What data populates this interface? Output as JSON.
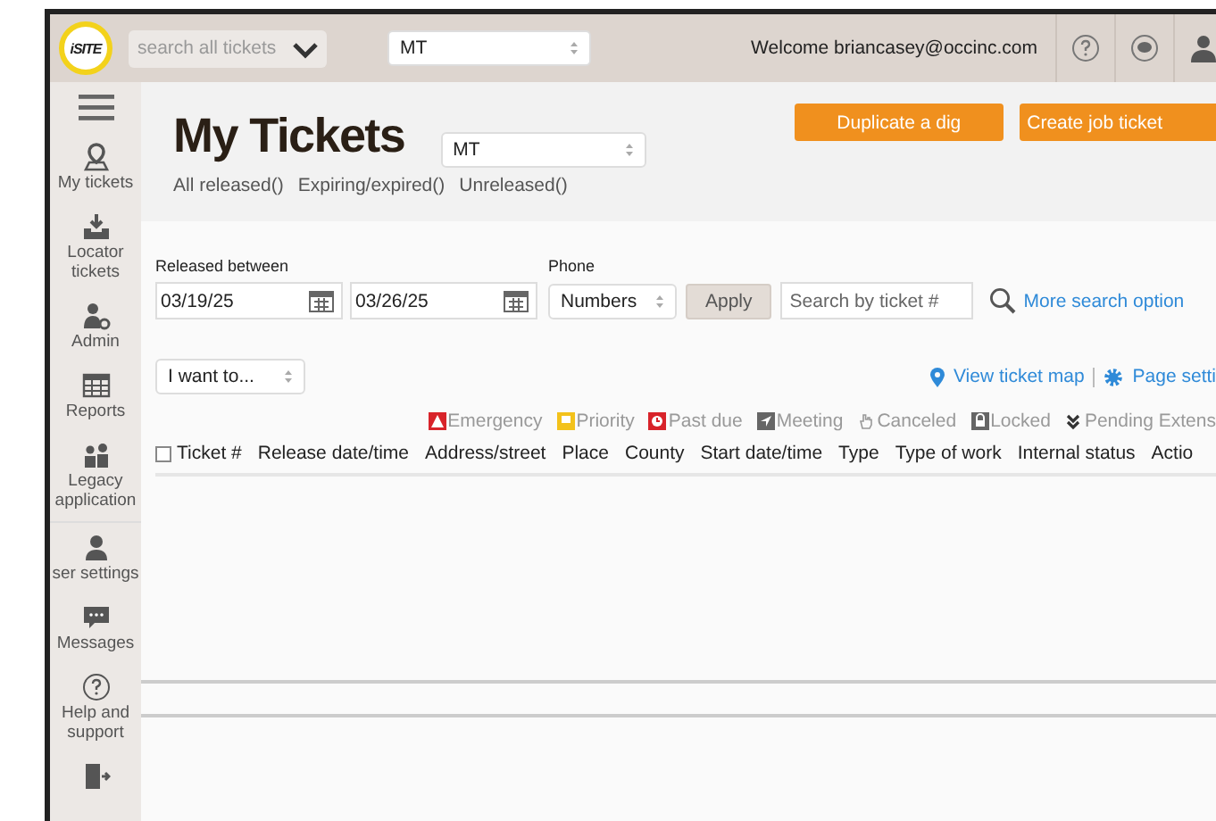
{
  "top_bar": {
    "logo": "iSITE",
    "search": {
      "placeholder": "search all tickets"
    },
    "state_select": "MT",
    "welcome": "Welcome briancasey@occinc.com"
  },
  "sidebar": {
    "items": [
      {
        "kind": "tickets",
        "label": "My tickets"
      },
      {
        "kind": "locator",
        "label": "Locator tickets"
      },
      {
        "kind": "admin",
        "label": "Admin"
      },
      {
        "kind": "reports",
        "label": "Reports"
      },
      {
        "kind": "legacy",
        "label": "Legacy application"
      },
      {
        "kind": "user",
        "label": "ser settings"
      },
      {
        "kind": "messages",
        "label": "Messages"
      },
      {
        "kind": "help",
        "label": "Help and support"
      },
      {
        "kind": "logout"
      }
    ]
  },
  "header": {
    "title": "My Tickets",
    "region_select": "MT",
    "buttons": [
      "Duplicate a dig",
      "Create job ticket"
    ],
    "filter_links": [
      "All released()",
      "Expiring/expired()",
      "Unreleased()"
    ]
  },
  "filters": {
    "released_label": "Released between",
    "from": "03/19/25",
    "to": "03/26/25",
    "phone_label": "Phone",
    "phone_select": "Numbers",
    "apply": "Apply",
    "ticket_search": {
      "placeholder": "Search by ticket #"
    },
    "more_link": "More search option"
  },
  "actions": {
    "select": "I want to...",
    "map_link": "View ticket map",
    "settings_link": "Page setti"
  },
  "legend": [
    {
      "kind": "emergency",
      "label": "Emergency"
    },
    {
      "kind": "priority",
      "label": "Priority"
    },
    {
      "kind": "pastdue",
      "label": "Past due"
    },
    {
      "kind": "meeting",
      "label": "Meeting"
    },
    {
      "kind": "canceled",
      "label": "Canceled"
    },
    {
      "kind": "locked",
      "label": "Locked"
    },
    {
      "kind": "pending",
      "label": "Pending Extens"
    }
  ],
  "table": {
    "select_all_checked": false,
    "columns": [
      "Ticket #",
      "Release date/time",
      "Address/street",
      "Place",
      "County",
      "Start date/time",
      "Type",
      "Type of work",
      "Internal status",
      "Actio"
    ]
  }
}
